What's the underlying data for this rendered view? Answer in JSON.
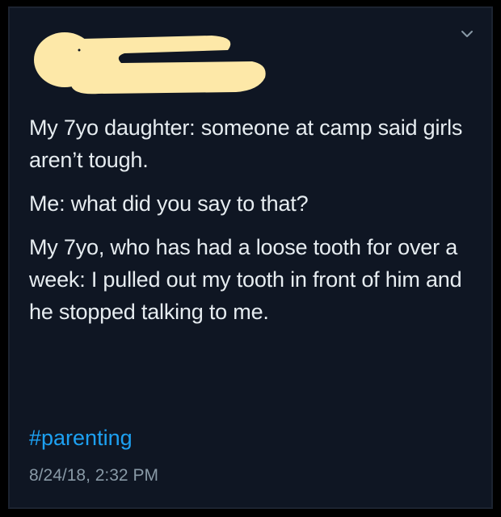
{
  "colors": {
    "background": "#0f1623",
    "text": "#e6ecf0",
    "link": "#1da1f2",
    "muted": "#8899a6",
    "redaction": "#fde8a8"
  },
  "header": {
    "menu_icon": "chevron-down-icon"
  },
  "tweet": {
    "paragraphs": [
      "My 7yo daughter: someone at camp said girls aren’t tough.",
      "Me: what did you say to that?",
      "My 7yo, who has had a loose tooth for over a week: I pulled out my tooth in front of him and he stopped talking to me."
    ],
    "hashtag": "#parenting",
    "timestamp": "8/24/18, 2:32 PM"
  }
}
